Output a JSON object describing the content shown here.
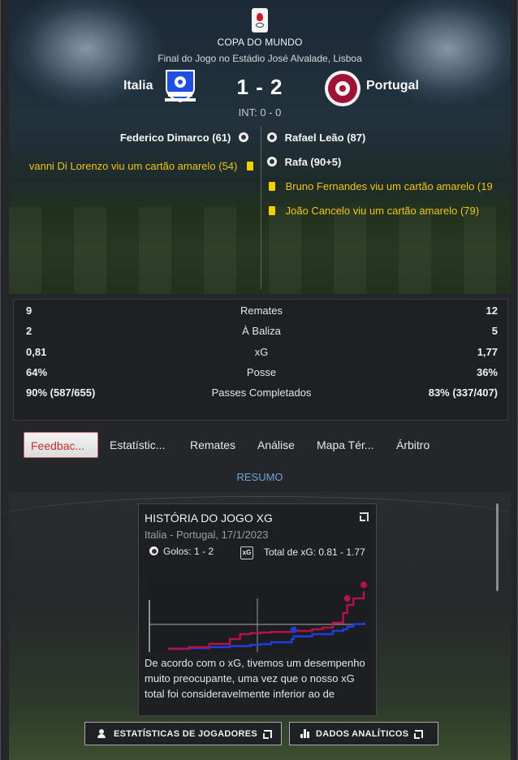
{
  "header": {
    "competition": "COPA DO MUNDO",
    "venue": "Final do Jogo no Estádio José Alvalade, Lisboa",
    "home_team": "Italia",
    "away_team": "Portugal",
    "score": "1 - 2",
    "half_time": "INT: 0 - 0"
  },
  "events": {
    "home": [
      {
        "text": "Federico Dimarco (61)",
        "type": "goal"
      },
      {
        "text": "vanni Di Lorenzo viu um cartão amarelo (54)",
        "type": "yellow"
      }
    ],
    "away": [
      {
        "text": "Rafael Leão (87)",
        "type": "goal"
      },
      {
        "text": "Rafa (90+5)",
        "type": "goal"
      },
      {
        "text": "Bruno Fernandes viu um cartão amarelo (19",
        "type": "yellow"
      },
      {
        "text": "João Cancelo viu um cartão amarelo (79)",
        "type": "yellow"
      }
    ]
  },
  "stats": [
    {
      "home": "9",
      "label": "Remates",
      "away": "12"
    },
    {
      "home": "2",
      "label": "À Baliza",
      "away": "5"
    },
    {
      "home": "0,81",
      "label": "xG",
      "away": "1,77"
    },
    {
      "home": "64%",
      "label": "Posse",
      "away": "36%"
    },
    {
      "home": "90% (587/655)",
      "label": "Passes Completados",
      "away": "83% (337/407)"
    }
  ],
  "tabs": [
    "Feedbac...",
    "Estatístic...",
    "Remates",
    "Análise",
    "Mapa Tér...",
    "Árbitro"
  ],
  "active_tab": "Feedbac...",
  "section_label": "RESUMO",
  "xg_card": {
    "title": "HISTÓRIA DO JOGO XG",
    "subtitle": "Italia - Portugal, 17/1/2023",
    "goals": "Golos: 1 - 2",
    "xg_icon": "xG",
    "xg_total": "Total de xG: 0.81 - 1.77",
    "text": "De acordo com o xG, tivemos um desempenho muito preocupante, uma vez que o nosso xG total foi consideravelmente inferior ao de",
    "colors": {
      "home": "#1f3de0",
      "away": "#b3124a"
    }
  },
  "chart_data": {
    "type": "line",
    "series": [
      {
        "x": [
          0,
          10,
          20,
          30,
          40,
          45,
          50,
          60,
          61,
          70,
          80,
          85,
          87,
          90,
          95
        ],
        "values": [
          0,
          0.02,
          0.05,
          0.08,
          0.12,
          0.14,
          0.2,
          0.3,
          0.38,
          0.45,
          0.55,
          0.6,
          0.68,
          0.76,
          0.81
        ]
      },
      {
        "x": [
          0,
          10,
          20,
          30,
          35,
          40,
          45,
          50,
          60,
          70,
          75,
          80,
          85,
          87,
          90,
          95
        ],
        "values": [
          0,
          0.05,
          0.15,
          0.3,
          0.45,
          0.48,
          0.5,
          0.52,
          0.55,
          0.6,
          0.65,
          0.8,
          1.1,
          1.35,
          1.55,
          1.77
        ]
      }
    ],
    "goals": [
      {
        "series": 0,
        "x": 61
      },
      {
        "series": 1,
        "x": 87
      },
      {
        "series": 1,
        "x": 95
      }
    ],
    "xlim": [
      0,
      95
    ],
    "ylim": [
      0,
      2
    ]
  },
  "buttons": {
    "players": "ESTATÍSTICAS DE JOGADORES",
    "analytics": "DADOS ANALÍTICOS"
  }
}
